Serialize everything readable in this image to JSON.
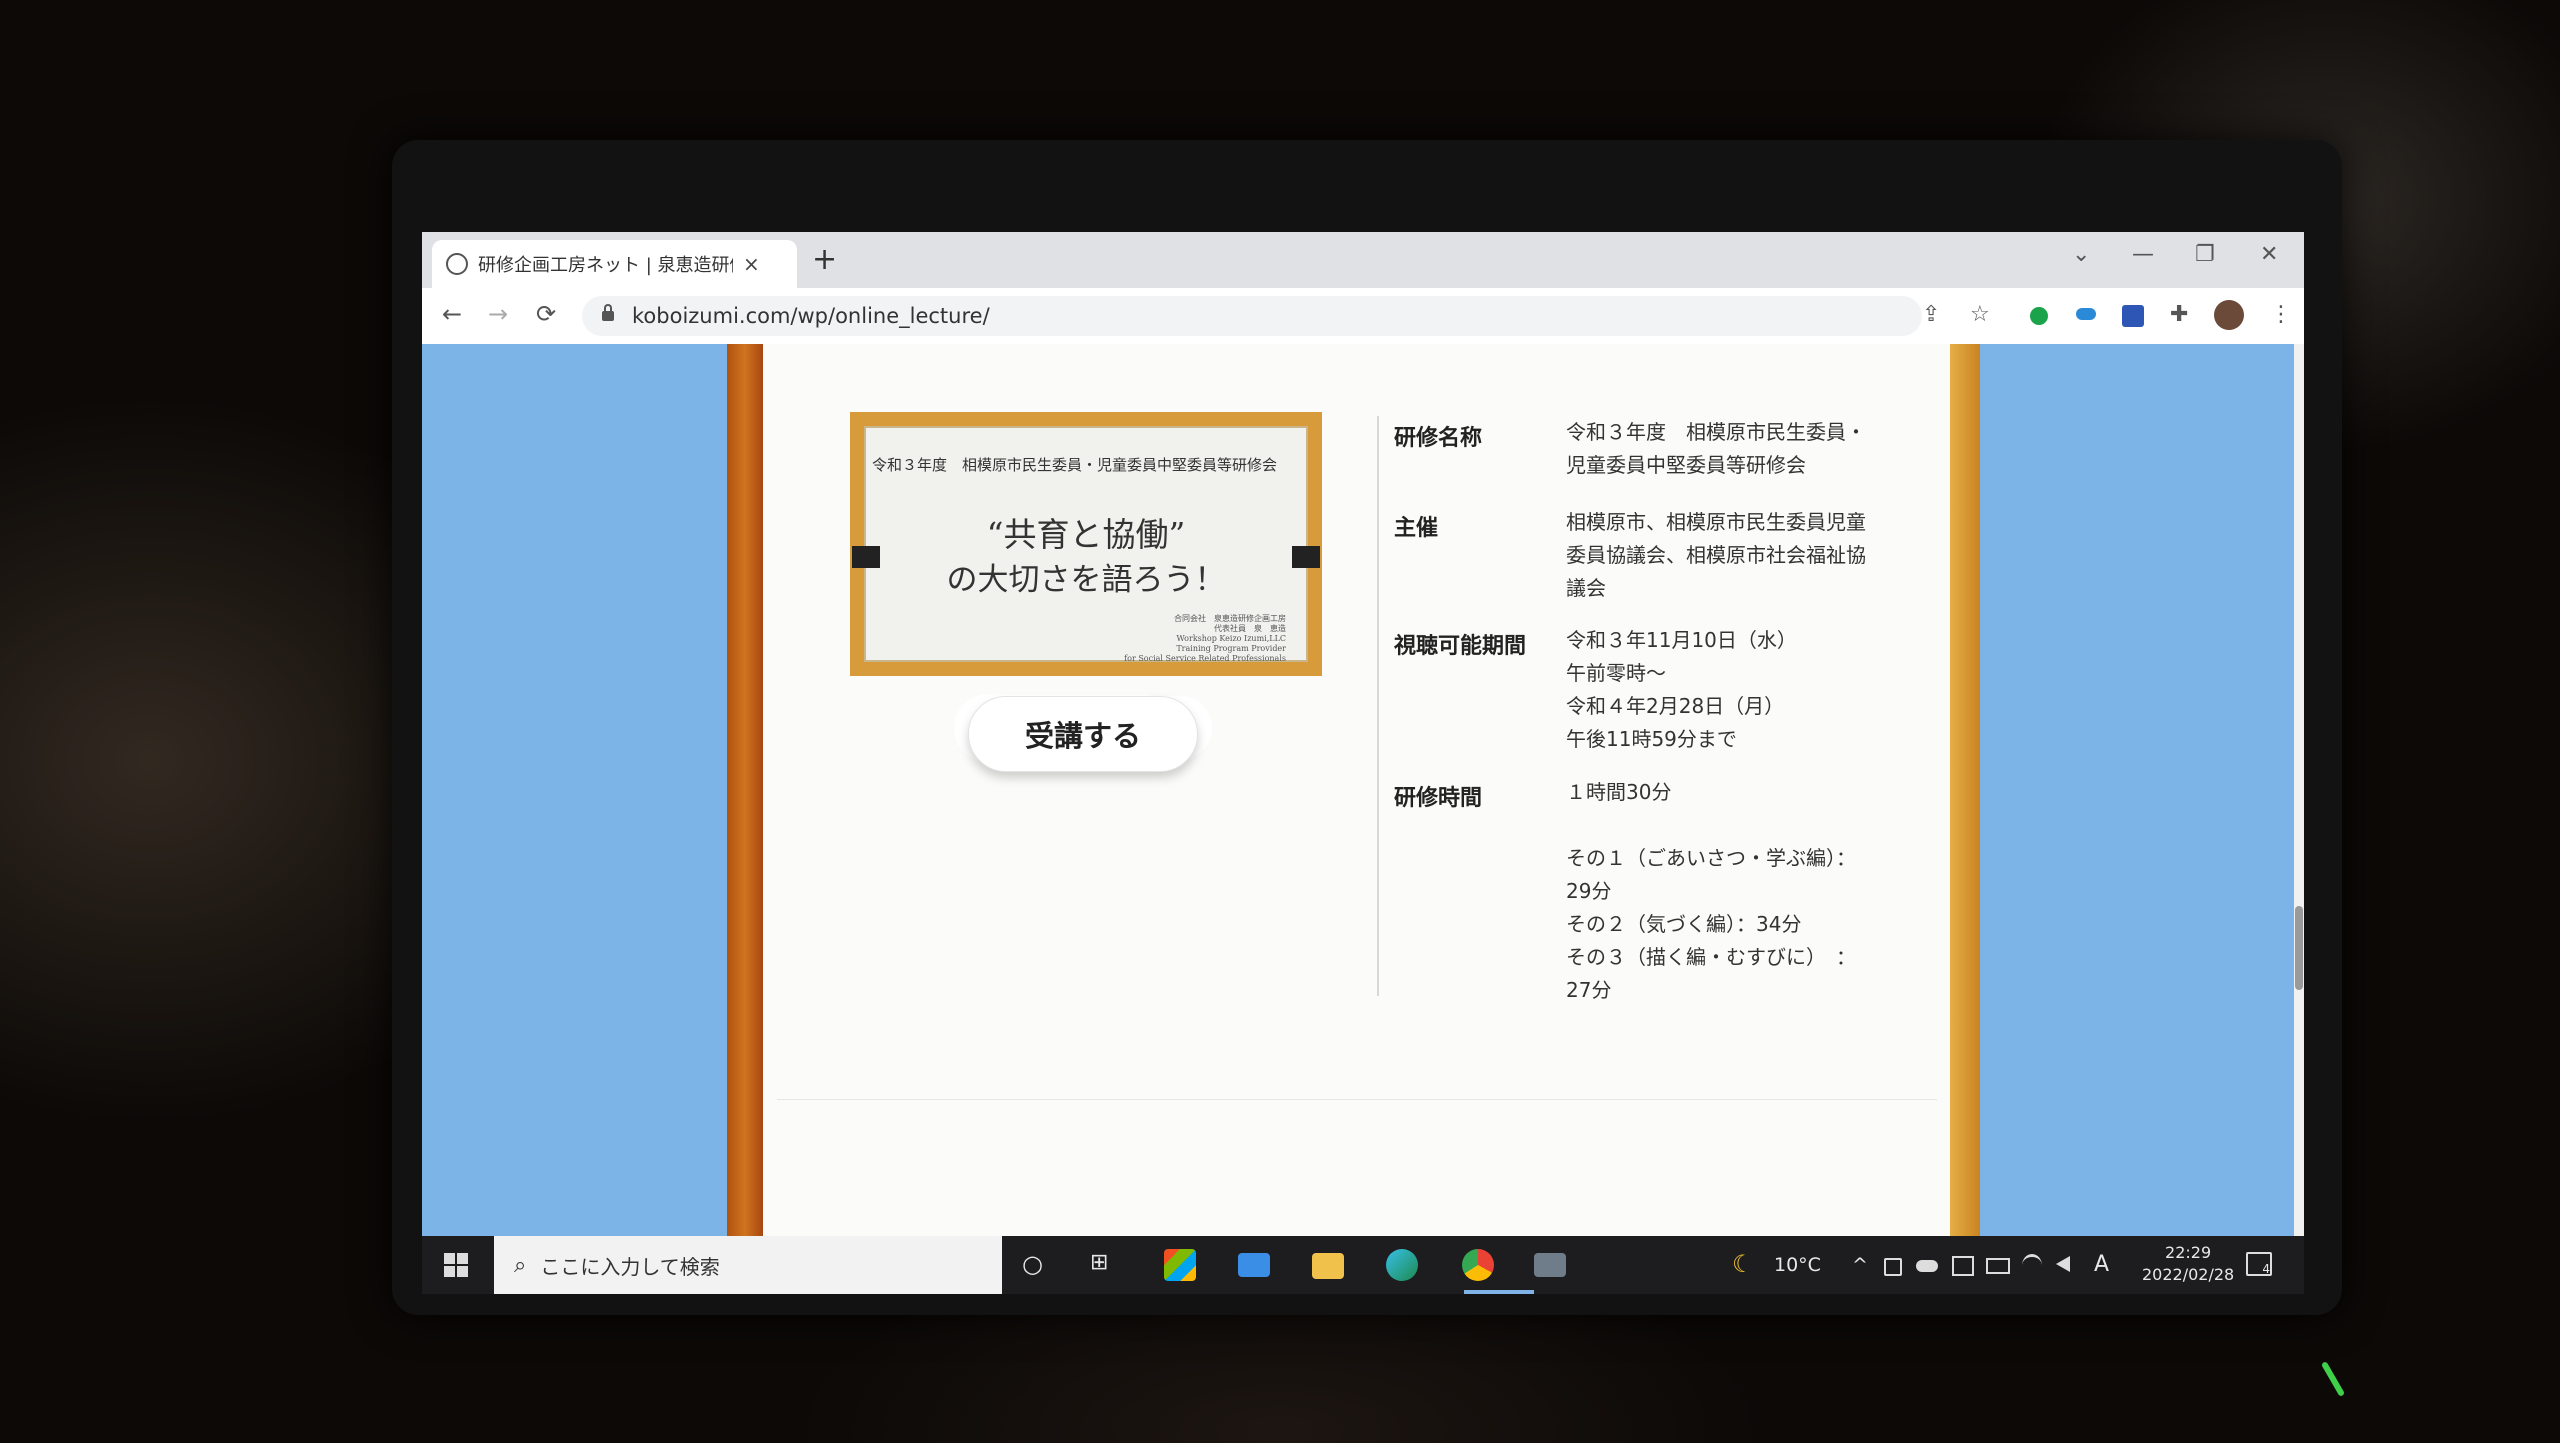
{
  "browser": {
    "tab_title": "研修企画工房ネット | 泉恵造研修企",
    "tab_close": "×",
    "new_tab": "+",
    "url": "koboizumi.com/wp/online_lecture/",
    "nav_back": "←",
    "nav_forward": "→",
    "nav_reload": "⟳",
    "share_icon": "⇪",
    "star_icon": "☆",
    "puzzle_icon": "✚",
    "menu_icon": "⋮",
    "win_tabsearch": "⌄",
    "win_min": "—",
    "win_max": "❐",
    "win_close": "✕"
  },
  "card": {
    "subtitle": "令和３年度　相模原市民生委員・児童委員中堅委員等研修会",
    "title_line1": "“共育と協働”",
    "title_line2": "の大切さを語ろう！",
    "credit": "合同会社　泉恵造研修企画工房\n代表社員　泉　恵造\nWorkshop Keizo Izumi,LLC\nTraining Program Provider\nfor Social Service Related Professionals"
  },
  "cta": {
    "label": "受講する"
  },
  "info": [
    {
      "label": "研修名称",
      "value": "令和３年度　相模原市民生委員・児童委員中堅委員等研修会"
    },
    {
      "label": "主催",
      "value": "相模原市、相模原市民生委員児童委員協議会、相模原市社会福祉協議会"
    },
    {
      "label": "視聴可能期間",
      "value": "令和３年11月10日（水）\n午前零時～\n令和４年2月28日（月）\n午後11時59分まで"
    },
    {
      "label": "研修時間",
      "value": "１時間30分\n\nその１（ごあいさつ・学ぶ編）：29分\nその２（気づく編）：34分\nその３（描く編・むすびに）　：27分"
    }
  ],
  "taskbar": {
    "search_placeholder": "ここに入力して検索",
    "search_icon": "⌕",
    "cortana_icon": "○",
    "taskview_icon": "⊞",
    "weather_icon": "☾",
    "temperature": "10°C",
    "tray_chevron": "^",
    "ime": "A",
    "time": "22:29",
    "date": "2022/02/28",
    "notification_count": "4"
  },
  "colors": {
    "page_bg": "#7cb4e8",
    "wood_left": "#c8691a",
    "wood_right": "#d69a34",
    "card_frame": "#d89b3c"
  }
}
